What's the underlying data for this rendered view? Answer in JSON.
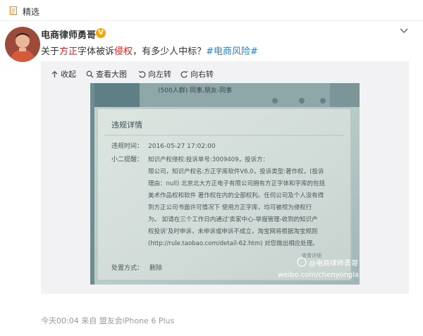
{
  "topbar": {
    "title": "精选",
    "icon": "document-icon"
  },
  "post": {
    "username": "电商律师勇哥",
    "verified_badge": "V",
    "text_parts": [
      "关于",
      "方正",
      "字体被诉",
      "侵权",
      "，有多少人中标？",
      "#电商风险#"
    ]
  },
  "toolbar": {
    "collapse": "收起",
    "view_large": "查看大图",
    "rotate_left": "向左转",
    "rotate_right": "向右转"
  },
  "photo": {
    "top_bar_text": "(500人群) 同事,朋友-同事",
    "dialog_title": "违规详情",
    "time_label": "违规时间：",
    "time_value": "2016-05-27 17:02:00",
    "note_label": "小二提醒：",
    "lines": [
      "知识产权侵权:投诉单号:3009409，投诉方：",
      "限公司，知识产权名:方正字库软件V6.0，投诉类型:著作权，(投诉",
      "理由：null) 北京北大方正电子有限公司拥有方正字体和字库的包括",
      "美术作品权和软件 著作权在内的全部权利。任何公司及个人没有得",
      "到方正公司书面许可情况下 使用方正字库，均可被视为侵权行",
      "为。 如请在三个工作日内通过'卖家中心-举报管理-收到的知识产",
      "权投诉'及时申诉，未申诉或申诉不成立，淘宝网将根据淘宝规则",
      "(http://rule.taobao.com/detail-62.htm) 对您做出相应处理。"
    ],
    "faded_link": "查看详细",
    "action_label": "处置方式：",
    "action_value": "删除",
    "watermark_handle": "@电商律师勇哥",
    "watermark_url": "weibo.com/chenyonglawyer"
  },
  "footer": {
    "text": "今天00:04 来自 盟友会iPhone 6 Plus"
  }
}
